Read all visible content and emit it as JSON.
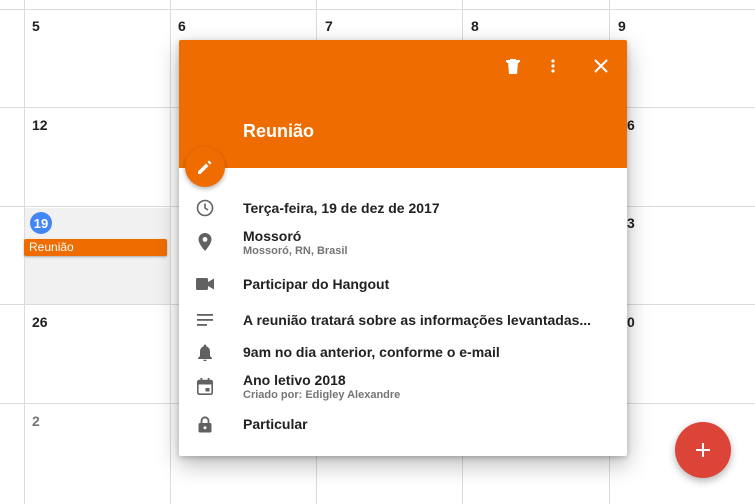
{
  "calendar": {
    "days": {
      "d5": "5",
      "d6": "6",
      "d7": "7",
      "d8": "8",
      "d9": "9",
      "d12": "12",
      "d16": "6",
      "d19": "19",
      "d23": "3",
      "d26": "26",
      "d30": "0",
      "d2": "2"
    },
    "event_chip": "Reunião",
    "today_color": "#4285f4"
  },
  "popup": {
    "accent": "#ef6c00",
    "title": "Reunião",
    "date": "Terça-feira, 19 de dez de 2017",
    "location": "Mossoró",
    "location_detail": "Mossoró, RN, Brasil",
    "hangout": "Participar do Hangout",
    "description": "A reunião tratará sobre as informações levantadas...",
    "reminder": "9am no dia anterior, conforme o e-mail",
    "calendar_name": "Ano letivo 2018",
    "created_by": "Criado por: Edigley Alexandre",
    "visibility": "Particular",
    "icons": {
      "delete": "trash-icon",
      "more": "more-vert-icon",
      "close": "close-icon",
      "edit": "pencil-icon",
      "time": "clock-icon",
      "location": "location-pin-icon",
      "video": "video-camera-icon",
      "description": "notes-icon",
      "reminder": "bell-icon",
      "calendar": "calendar-icon",
      "visibility": "lock-icon"
    }
  },
  "fab": {
    "icon": "plus-icon",
    "color": "#db4437"
  }
}
